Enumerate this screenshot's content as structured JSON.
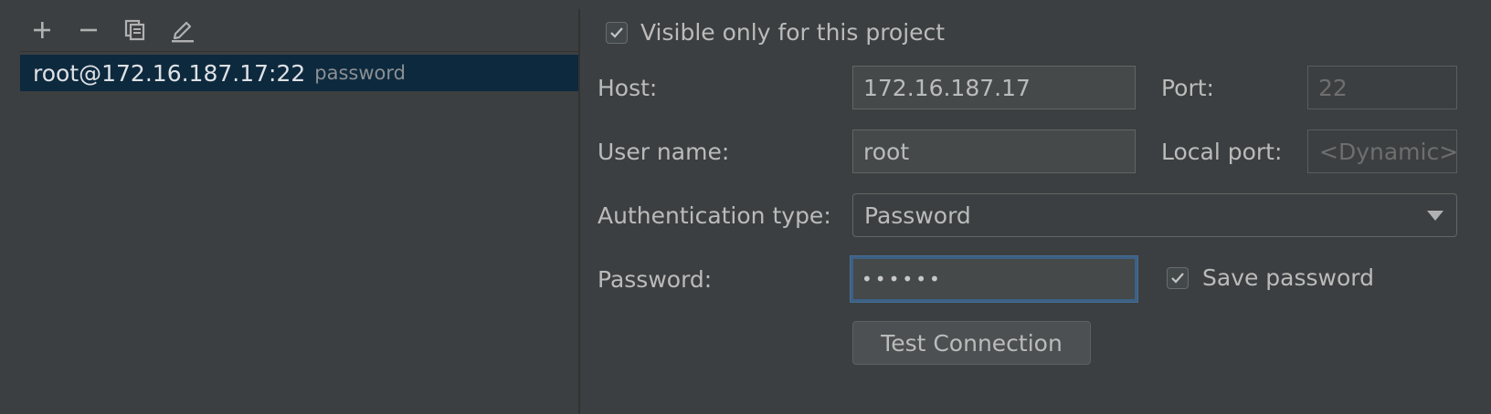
{
  "toolbar": {
    "icons": [
      "add-icon",
      "remove-icon",
      "copy-icon",
      "edit-icon"
    ]
  },
  "servers": [
    {
      "name": "root@172.16.187.17:22",
      "auth": "password"
    }
  ],
  "form": {
    "visible_only_label": "Visible only for this project",
    "visible_only_checked": true,
    "host_label": "Host:",
    "host_value": "172.16.187.17",
    "port_label": "Port:",
    "port_value": "22",
    "username_label": "User name:",
    "username_value": "root",
    "local_port_label": "Local port:",
    "local_port_value": "<Dynamic>",
    "auth_type_label": "Authentication type:",
    "auth_type_value": "Password",
    "password_label": "Password:",
    "password_value": "••••••",
    "save_password_label": "Save password",
    "save_password_checked": true,
    "test_connection_label": "Test Connection"
  },
  "colors": {
    "background": "#3c3f41",
    "selection": "#0d293e",
    "focus": "#3d6185"
  }
}
